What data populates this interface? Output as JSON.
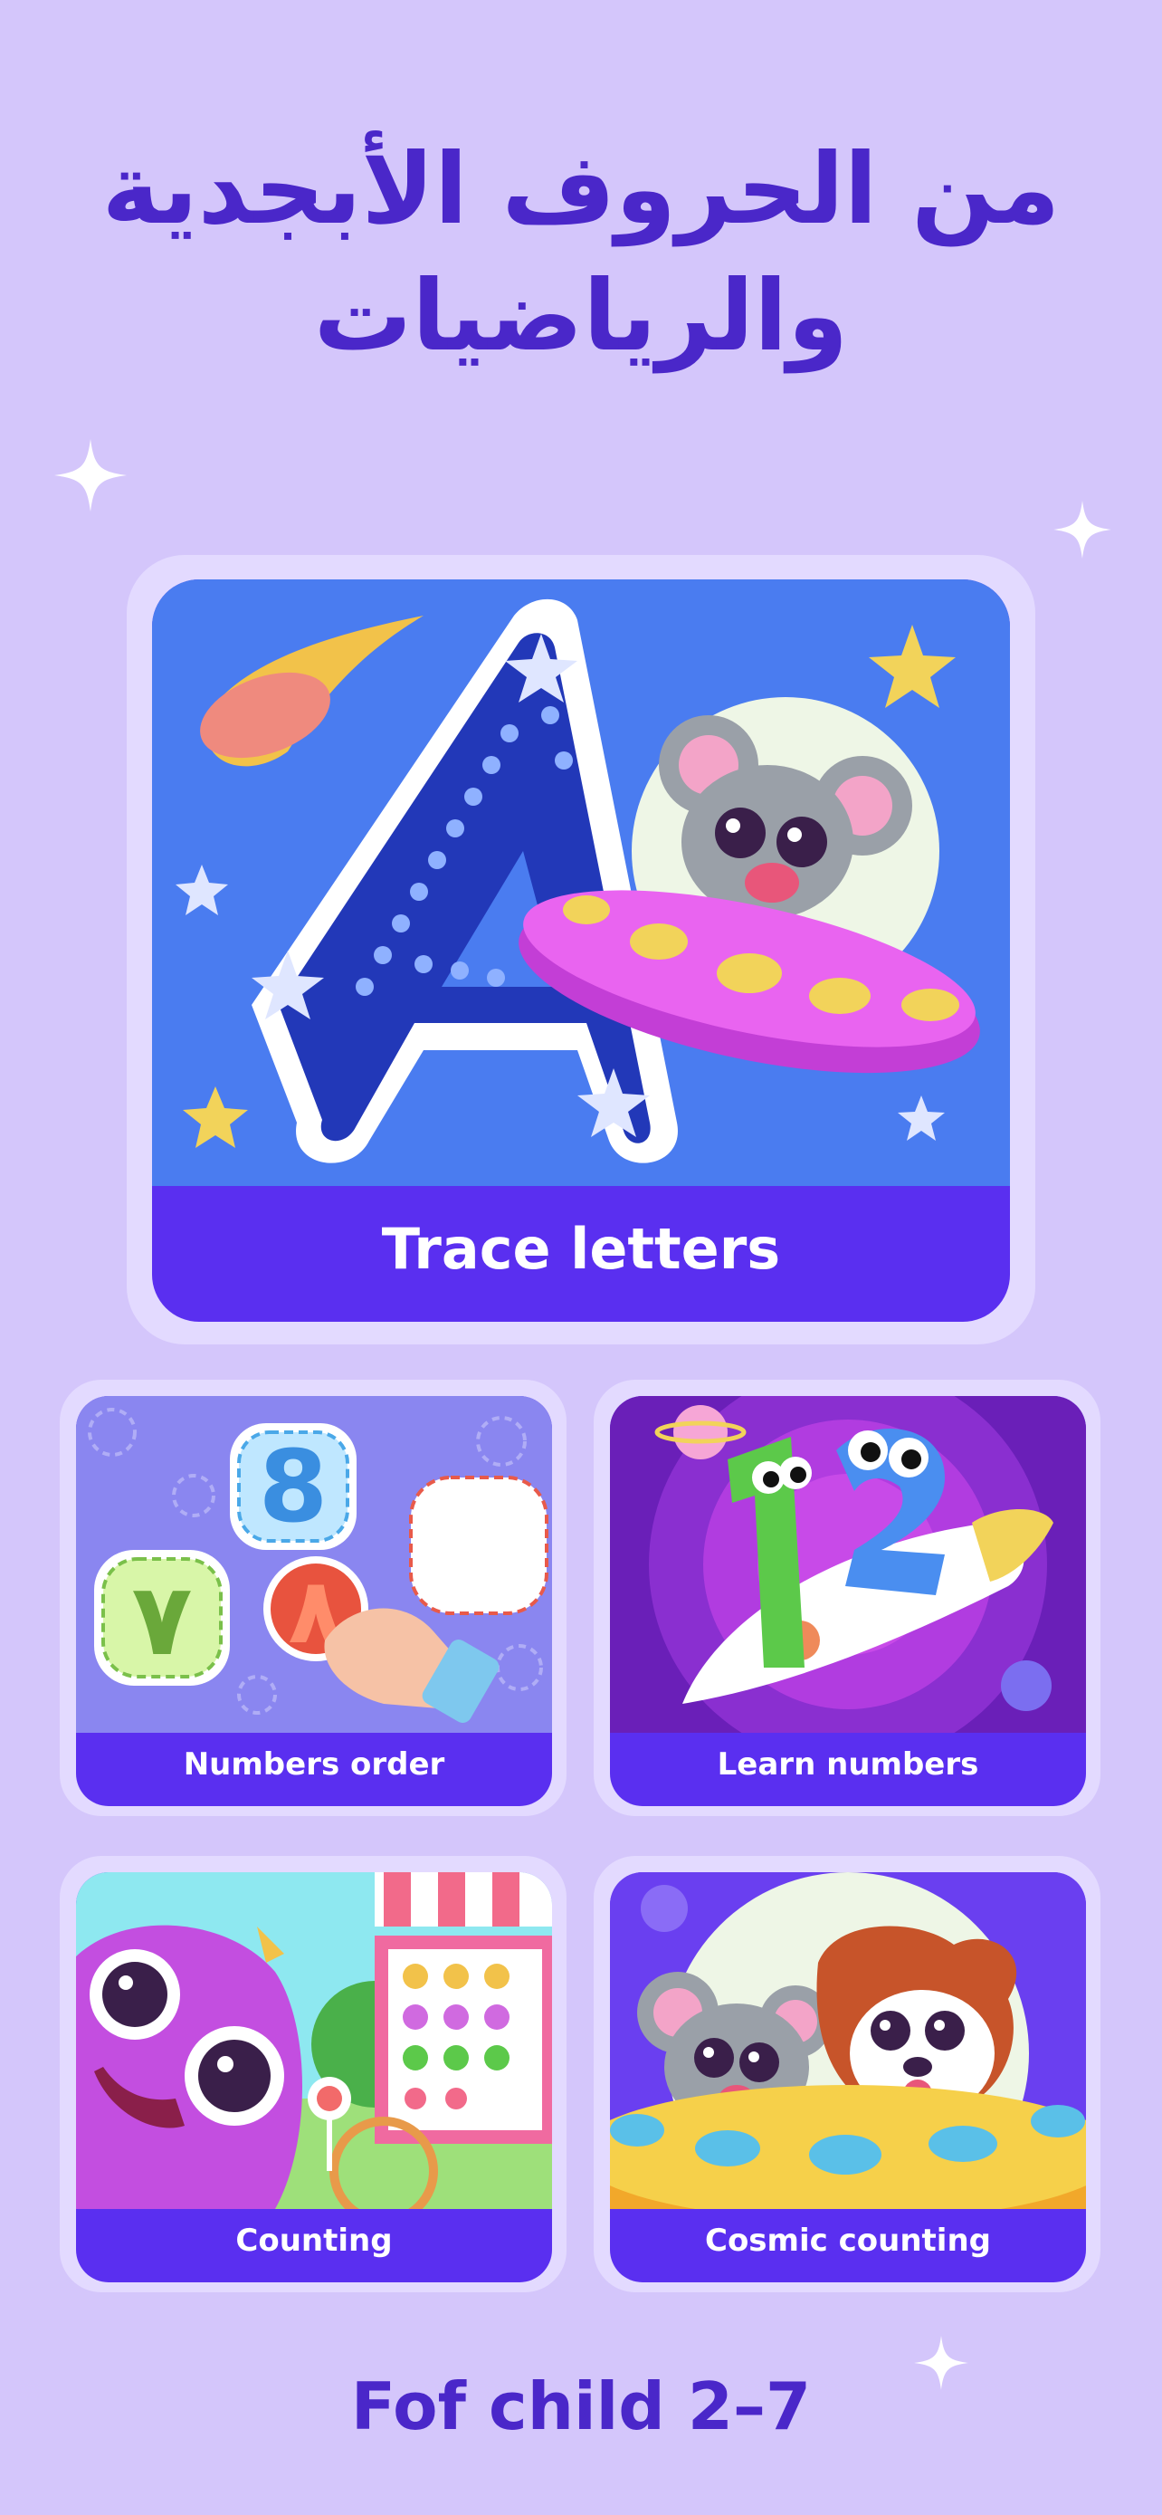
{
  "headline": {
    "line1": "من الحروف الأبجدية",
    "line2": "والرياضيات"
  },
  "cards": {
    "trace_letters": {
      "label": "Trace letters",
      "icon": "letter-a-ufo-mouse-illustration"
    },
    "numbers_order": {
      "label": "Numbers order",
      "icon": "numbers-puzzle-illustration"
    },
    "learn_numbers": {
      "label": "Learn numbers",
      "icon": "number-characters-rocket-illustration"
    },
    "counting": {
      "label": "Counting",
      "icon": "monster-candy-shop-illustration"
    },
    "cosmic_counting": {
      "label": "Cosmic counting",
      "icon": "mouse-dog-ufo-illustration"
    }
  },
  "footer": {
    "text": "Fof child 2–7"
  },
  "colors": {
    "background": "#d4c6fb",
    "accent": "#4a27c9",
    "label_bar": "#5a2ff0",
    "frame": "#e3daff"
  }
}
